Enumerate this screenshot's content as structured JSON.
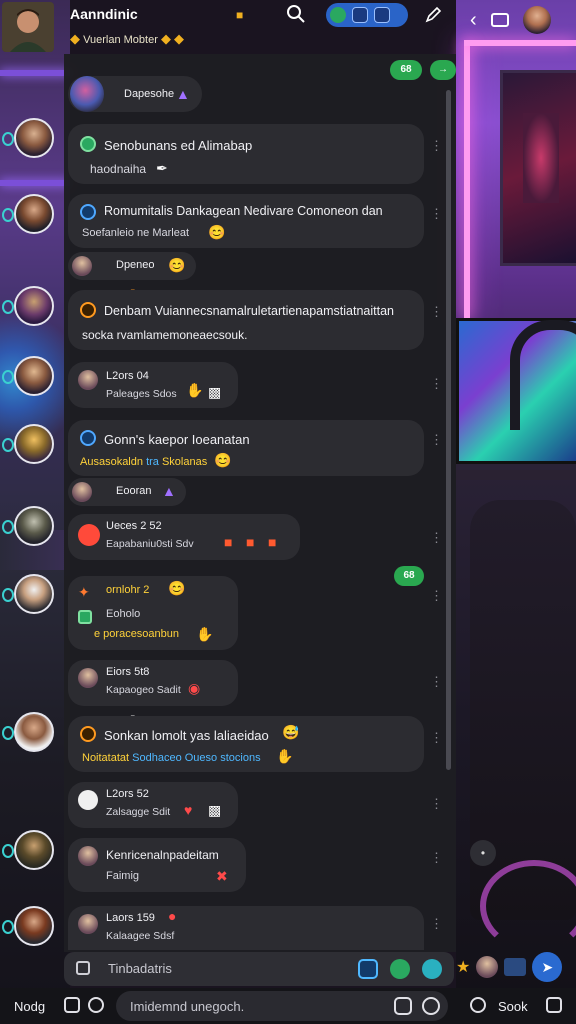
{
  "header": {
    "title": "Aanndinic",
    "subtitle": "Vuerlan Mobter",
    "status_icon": "diamond-icon"
  },
  "messages": [
    {
      "top_label": "Dapesohe"
    },
    {
      "title": "Senobunans ed Alimabap",
      "sub": "haodnaiha"
    },
    {
      "title": "Romumitalis Dankagean Nedivare Comoneon dan",
      "sub": "Soefanleio ne Marleat"
    },
    {
      "reaction": "Dpeneo"
    },
    {
      "title": "Denbam Vuiannecsnamalruletartienapamstiatnaittan",
      "sub": "socka rvamlamemoneaecsouk."
    },
    {
      "title": "L2ors 04",
      "sub": "Paleages Sdos"
    },
    {
      "title": "Gonn's kaepor Ioeanatan",
      "sub_yellow": "Ausasokaldn",
      "sub_blue": "tra",
      "sub_yellow2": "Skolanas"
    },
    {
      "reaction": "Eooran"
    },
    {
      "title": "Ueces 2 52",
      "sub": "Eapabaniu0sti Sdv"
    },
    {
      "title": "ornlohr 2",
      "sub": "Eoholo",
      "sub2": "e poracesoanbun"
    },
    {
      "title": "Eiors 5t8",
      "sub": "Kapaogeo Sadit"
    },
    {
      "title": "Sonkan lomolt yas laliaeidao",
      "sub_yellow": "Noitatatat",
      "sub_blue": "Sodhaceo Oueso stocions"
    },
    {
      "title": "L2ors 52",
      "sub": "Zalsagge Sdit"
    },
    {
      "title": "Kenricenalnpadeitam",
      "sub": "Faimig"
    },
    {
      "title": "Laors 159",
      "sub": "Kalaagee Sdsf"
    }
  ],
  "badges": {
    "top_green": "68",
    "mid_green": "68"
  },
  "composer": {
    "placeholder": "Tinbadatris"
  },
  "bottom": {
    "left_label": "Nodg",
    "input_placeholder": "Imidemnd unegoch.",
    "right_label": "Sook"
  }
}
